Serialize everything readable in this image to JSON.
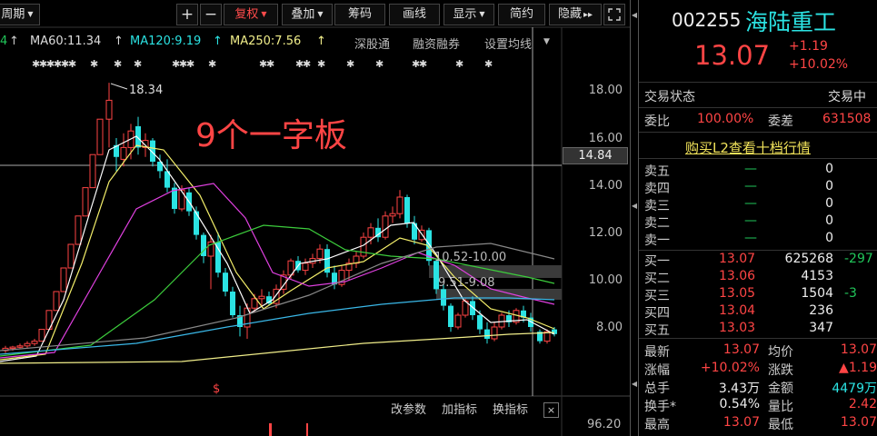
{
  "toolbar": {
    "period_label": "周期",
    "zoom_in": "+",
    "zoom_out": "−",
    "fuquan_label": "复权",
    "diejia_label": "叠加",
    "chouma_label": "筹码",
    "huaxian_label": "画线",
    "xianshi_label": "显示",
    "jianyue_label": "简约",
    "yincang_label": "隐藏",
    "more_glyph": "▸▸"
  },
  "indicators": {
    "ma_partial": "4",
    "ma60": "MA60:11.34",
    "ma120": "MA120:9.19",
    "ma250": "MA250:7.56",
    "links": [
      "深股通",
      "融资融券",
      "设置均线"
    ]
  },
  "chart": {
    "price_ticks": [
      "18.00",
      "16.00",
      "14.00",
      "12.00",
      "10.00",
      "8.00"
    ],
    "crosshair_price": "14.84",
    "high_label": "18.34",
    "annotation": "9个一字板",
    "band_labels": [
      "10.52-10.00",
      "9.51-9.08"
    ],
    "sub_links": [
      "改参数",
      "加指标",
      "换指标"
    ],
    "sub_close": "×",
    "volume_tick": "96.20",
    "colors": {
      "up": "#ff4545",
      "down": "#2be3e3",
      "ma5": "#ffffff",
      "ma10": "#f3ee6a",
      "ma20": "#e040e0",
      "ma60": "#3ccc3c",
      "ma120": "#3ab8e8",
      "ma250": "#f1ee8a"
    }
  },
  "quote": {
    "code": "002255",
    "name": "海陆重工",
    "price": "13.07",
    "change": "+1.19",
    "change_pct": "+10.02%",
    "status_label": "交易状态",
    "status_value": "交易中",
    "weibi_label": "委比",
    "weibi_value": "100.00%",
    "weicha_label": "委差",
    "weicha_value": "631508",
    "l2_link": "购买L2查看十档行情",
    "sell": [
      {
        "label": "卖五",
        "price": "—",
        "vol": "0"
      },
      {
        "label": "卖四",
        "price": "—",
        "vol": "0"
      },
      {
        "label": "卖三",
        "price": "—",
        "vol": "0"
      },
      {
        "label": "卖二",
        "price": "—",
        "vol": "0"
      },
      {
        "label": "卖一",
        "price": "—",
        "vol": "0"
      }
    ],
    "buy": [
      {
        "label": "买一",
        "price": "13.07",
        "vol": "625268",
        "delta": "-297"
      },
      {
        "label": "买二",
        "price": "13.06",
        "vol": "4153",
        "delta": ""
      },
      {
        "label": "买三",
        "price": "13.05",
        "vol": "1504",
        "delta": "-3"
      },
      {
        "label": "买四",
        "price": "13.04",
        "vol": "236",
        "delta": ""
      },
      {
        "label": "买五",
        "price": "13.03",
        "vol": "347",
        "delta": ""
      }
    ],
    "stats": [
      {
        "l1": "最新",
        "v1": "13.07",
        "l2": "均价",
        "v2": "13.07"
      },
      {
        "l1": "涨幅",
        "v1": "+10.02%",
        "l2": "涨跌",
        "v2": "▲1.19"
      },
      {
        "l1": "总手",
        "v1": "3.43万",
        "l2": "金额",
        "v2": "4479万"
      },
      {
        "l1": "换手*",
        "v1": "0.54%",
        "l2": "量比",
        "v2": "2.42"
      },
      {
        "l1": "最高",
        "v1": "13.07",
        "l2": "最低",
        "v2": "13.07"
      }
    ]
  }
}
